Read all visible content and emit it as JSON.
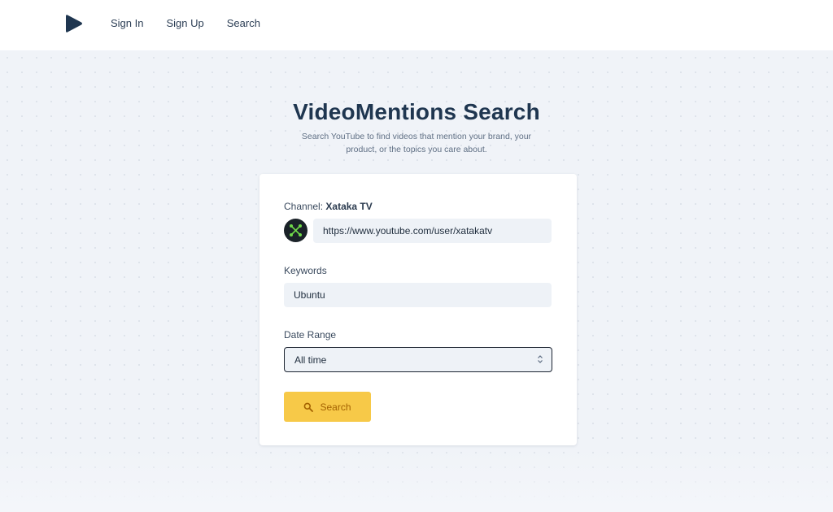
{
  "nav": {
    "items": [
      "Sign In",
      "Sign Up",
      "Search"
    ]
  },
  "hero": {
    "title": "VideoMentions Search",
    "subtitle": "Search YouTube to find videos that mention your brand, your product, or the topics you care about."
  },
  "form": {
    "channel_label": "Channel:",
    "channel_name": "Xataka TV",
    "channel_url": "https://www.youtube.com/user/xatakatv",
    "keywords_label": "Keywords",
    "keywords_value": "Ubuntu",
    "date_range_label": "Date Range",
    "date_range_value": "All time",
    "search_button": "Search"
  },
  "colors": {
    "brand": "#1f3650",
    "accent_button": "#f7c948",
    "button_text": "#a46200",
    "page_bg": "#f0f3f8",
    "input_bg": "#eef2f7"
  },
  "icons": {
    "logo": "play-logo-icon",
    "search": "search-icon",
    "select": "chevron-updown-icon",
    "avatar": "channel-avatar"
  }
}
